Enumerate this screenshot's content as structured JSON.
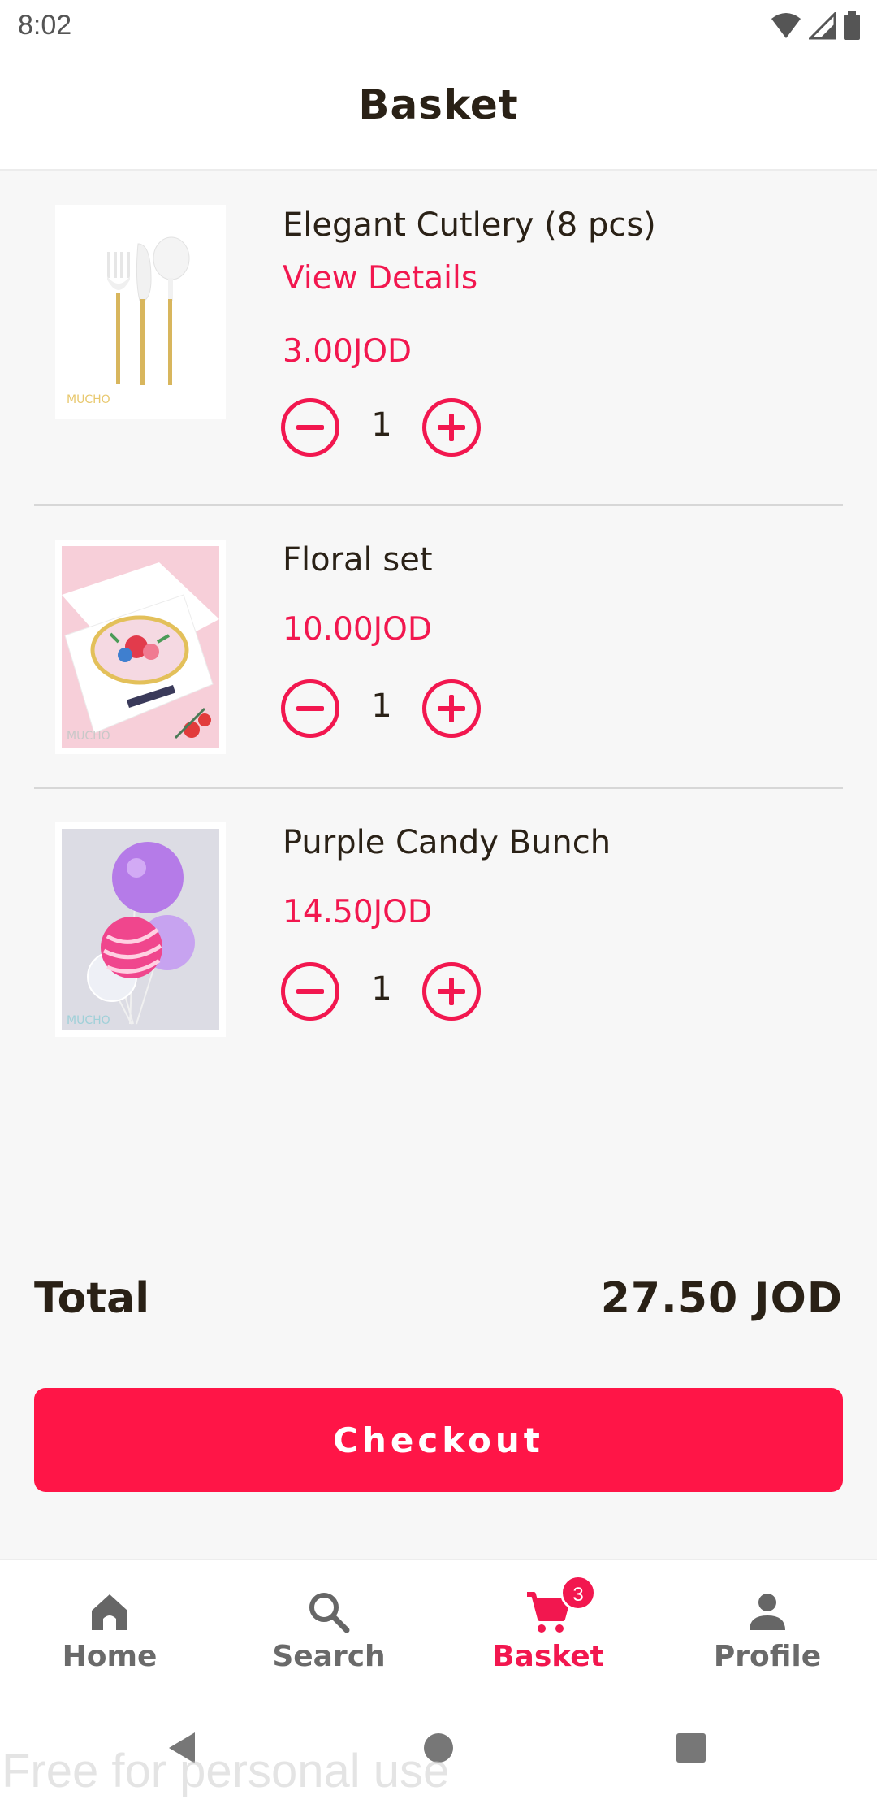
{
  "status_bar": {
    "time": "8:02"
  },
  "header": {
    "title": "Basket"
  },
  "basket": {
    "items": [
      {
        "name": "Elegant Cutlery (8 pcs)",
        "view_details": "View Details",
        "price": "3.00JOD",
        "quantity": "1",
        "image": "cutlery-image"
      },
      {
        "name": "Floral set",
        "price": "10.00JOD",
        "quantity": "1",
        "image": "floral-plates-image"
      },
      {
        "name": "Purple Candy Bunch",
        "price": "14.50JOD",
        "quantity": "1",
        "image": "balloons-image"
      }
    ]
  },
  "summary": {
    "total_label": "Total",
    "total_value": "27.50 JOD"
  },
  "checkout": {
    "label": "Checkout"
  },
  "bottom_nav": {
    "items": [
      {
        "label": "Home",
        "icon": "home-icon"
      },
      {
        "label": "Search",
        "icon": "search-icon"
      },
      {
        "label": "Basket",
        "icon": "cart-icon",
        "badge": "3",
        "active": true
      },
      {
        "label": "Profile",
        "icon": "person-icon"
      }
    ]
  },
  "watermark": "Free for personal use",
  "colors": {
    "accent": "#f2174f",
    "button": "#ff1547",
    "text": "#2a2116",
    "background": "#f7f7f7"
  }
}
